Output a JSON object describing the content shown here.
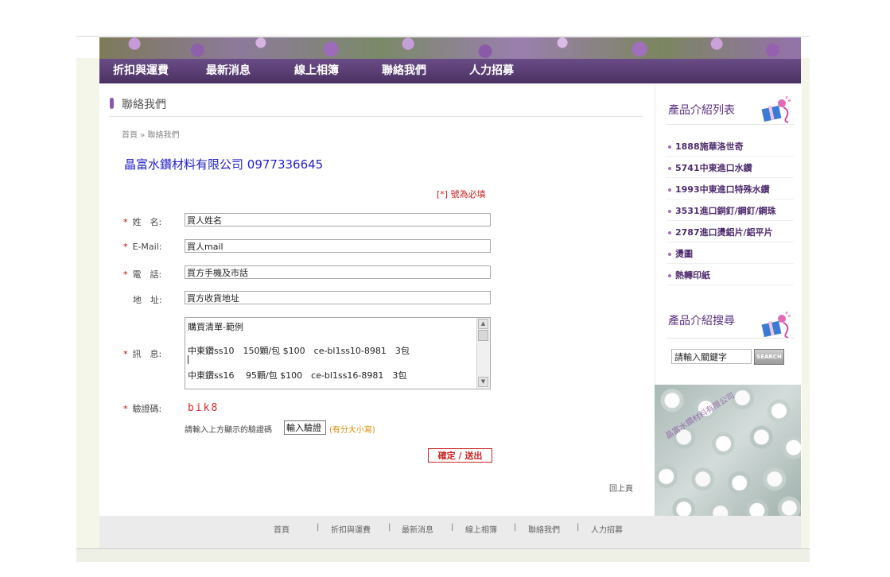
{
  "nav": {
    "items": [
      "折扣與運費",
      "最新消息",
      "線上相簿",
      "聯絡我們",
      "人力招募"
    ]
  },
  "page": {
    "title": "聯絡我們",
    "breadcrumb": "首頁 » 聯絡我們",
    "company": "晶富水鑽材料有限公司 0977336645",
    "required_note": "[*] 號為必填"
  },
  "form": {
    "required_mark": "*",
    "name": {
      "label": "姓　名:",
      "value": "買人姓名"
    },
    "email": {
      "label": "E-Mail:",
      "value": "買人mail"
    },
    "phone": {
      "label": "電　話:",
      "value": "買方手機及市話"
    },
    "address": {
      "label": "地　址:",
      "value": "買方收貨地址"
    },
    "message": {
      "label": "訊　息:",
      "lines": [
        "購買清單-範例",
        "",
        "中東鑽ss10　150顆/包 $100　ce-bl1ss10-8981　3包",
        "中東鑽ss16　 95顆/包 $100　ce-bl1ss16-8981　3包"
      ]
    },
    "captcha": {
      "label": "驗證碼:",
      "code": "bik8",
      "hint": "請輸入上方顯示的驗證碼",
      "input_value": "輸入驗證",
      "case_note": "(有分大小寫)"
    },
    "submit_label": "確定 / 送出"
  },
  "back_to_top": "回上頁",
  "footer": {
    "items": [
      "首頁",
      "折扣與運費",
      "最新消息",
      "線上相簿",
      "聯絡我們",
      "人力招募"
    ],
    "separator": "|"
  },
  "sidebar": {
    "product_list_heading": "產品介紹列表",
    "categories": [
      "1888施華洛世奇",
      "5741中東進口水鑽",
      "1993中東進口特殊水鑽",
      "3531進口銅釘/鋼釘/鋼珠",
      "2787進口燙鋁片/鋁平片",
      "燙圖",
      "熱轉印紙"
    ],
    "search_heading": "產品介紹搜尋",
    "search_input_value": "請輸入關鍵字",
    "search_button": "SEARCH",
    "photo_watermark": "晶富水鑽材料有限公司"
  },
  "colors": {
    "nav_bg": "#5a3d74",
    "accent_purple": "#5a2e82",
    "required_red": "#cc2222",
    "company_blue": "#2222cc"
  }
}
